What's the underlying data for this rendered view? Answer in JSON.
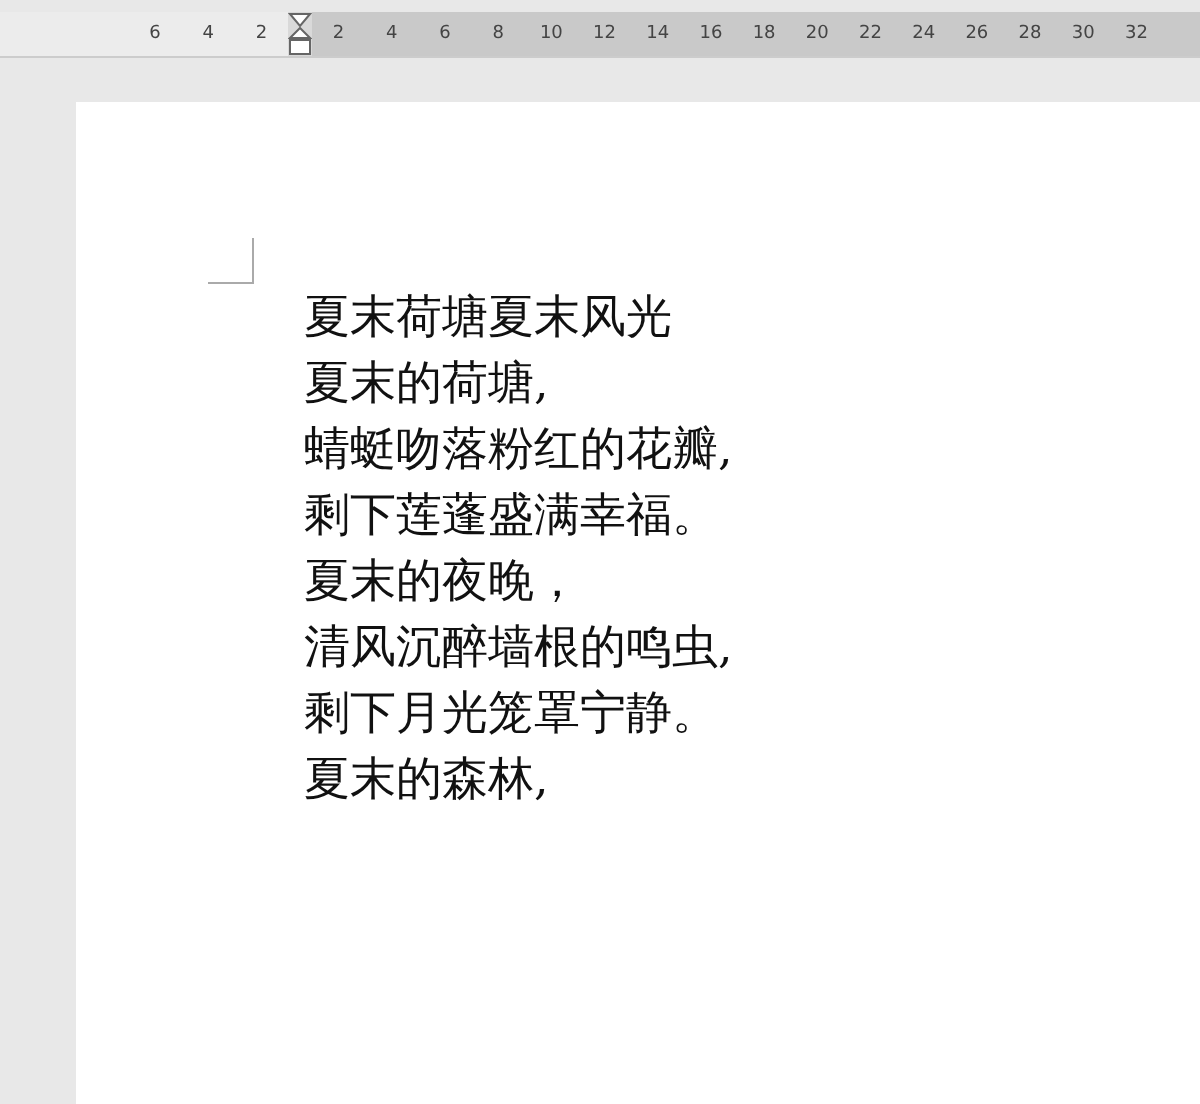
{
  "ruler": {
    "left_numbers": [
      "6",
      "4",
      "2"
    ],
    "right_numbers": [
      "2",
      "4",
      "6",
      "8",
      "10",
      "12",
      "14",
      "16",
      "18",
      "20",
      "22",
      "24",
      "26",
      "28",
      "30",
      "32"
    ]
  },
  "document": {
    "lines": [
      "夏末荷塘夏末风光",
      "夏末的荷塘,",
      "蜻蜓吻落粉红的花瓣,",
      "剩下莲蓬盛满幸福。",
      "夏末的夜晚，",
      "清风沉醉墙根的鸣虫,",
      "剩下月光笼罩宁静。",
      "夏末的森林,"
    ]
  }
}
